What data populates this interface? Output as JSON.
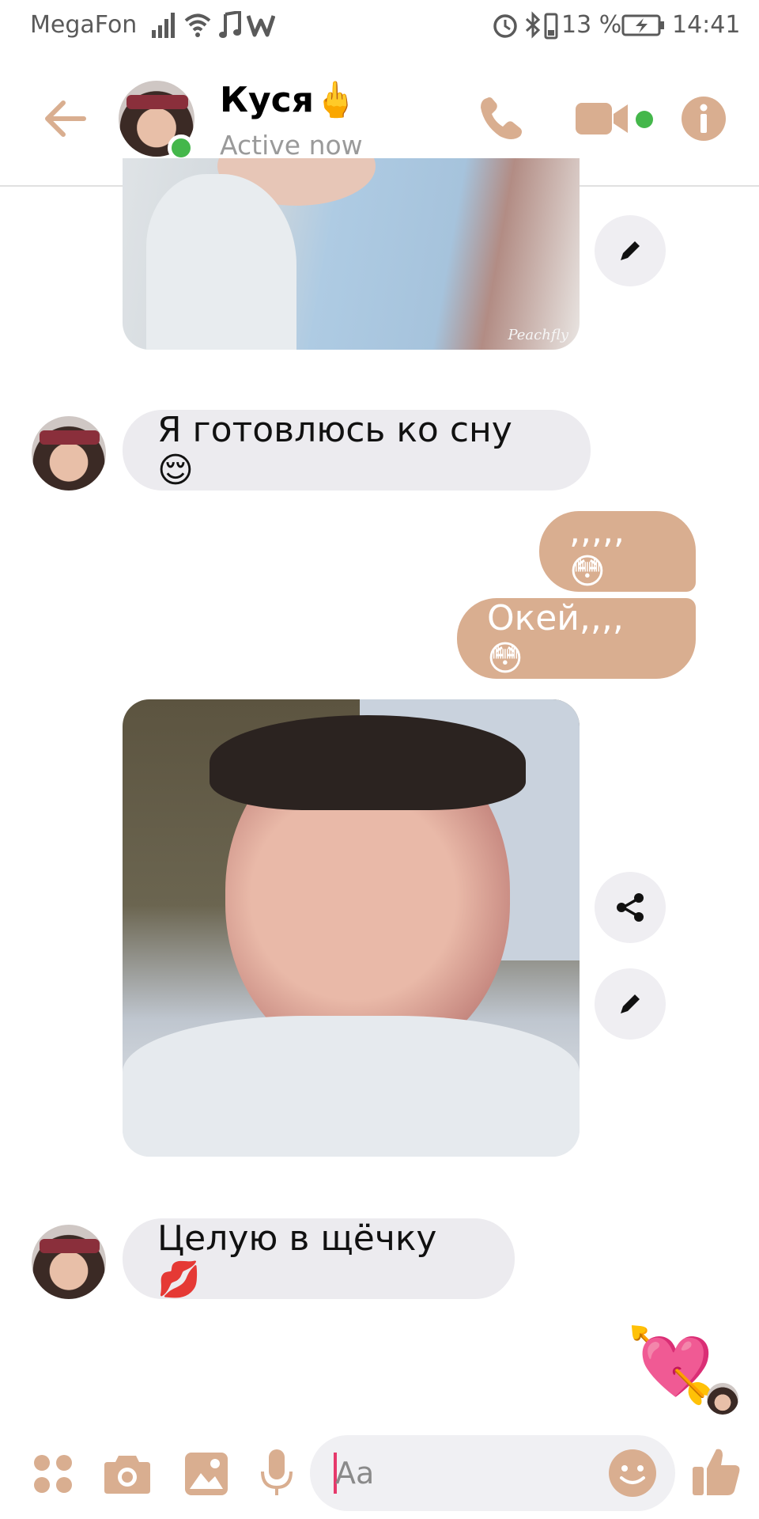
{
  "status_bar": {
    "carrier": "MegaFon",
    "battery": "13 %",
    "time": "14:41"
  },
  "header": {
    "contact_name": "Куся🖕",
    "contact_status": "Active now"
  },
  "messages": [
    {
      "type": "photo",
      "from": "them",
      "watermark": "Peachfly"
    },
    {
      "type": "text",
      "from": "them",
      "text": "Я готовлюсь ко сну 😌"
    },
    {
      "type": "text",
      "from": "me",
      "text": ",,,,, 😳"
    },
    {
      "type": "text",
      "from": "me",
      "text": "Окей,,,, 😳"
    },
    {
      "type": "photo",
      "from": "them"
    },
    {
      "type": "text",
      "from": "them",
      "text": "Целую в щёчку 💋"
    },
    {
      "type": "sticker",
      "from": "me",
      "emoji": "💘"
    }
  ],
  "composer": {
    "placeholder": "Aa"
  },
  "colors": {
    "accent": "#d9ae90",
    "online": "#44b74b",
    "incoming_bubble": "#ecebef",
    "caret": "#e6396b"
  },
  "icons": {
    "header": [
      "back-arrow-icon",
      "phone-icon",
      "video-camera-icon",
      "info-icon"
    ],
    "side_actions": [
      "share-icon",
      "pencil-icon"
    ],
    "composer": [
      "apps-grid-icon",
      "camera-icon",
      "gallery-icon",
      "microphone-icon",
      "emoji-icon",
      "thumbs-up-icon"
    ]
  }
}
